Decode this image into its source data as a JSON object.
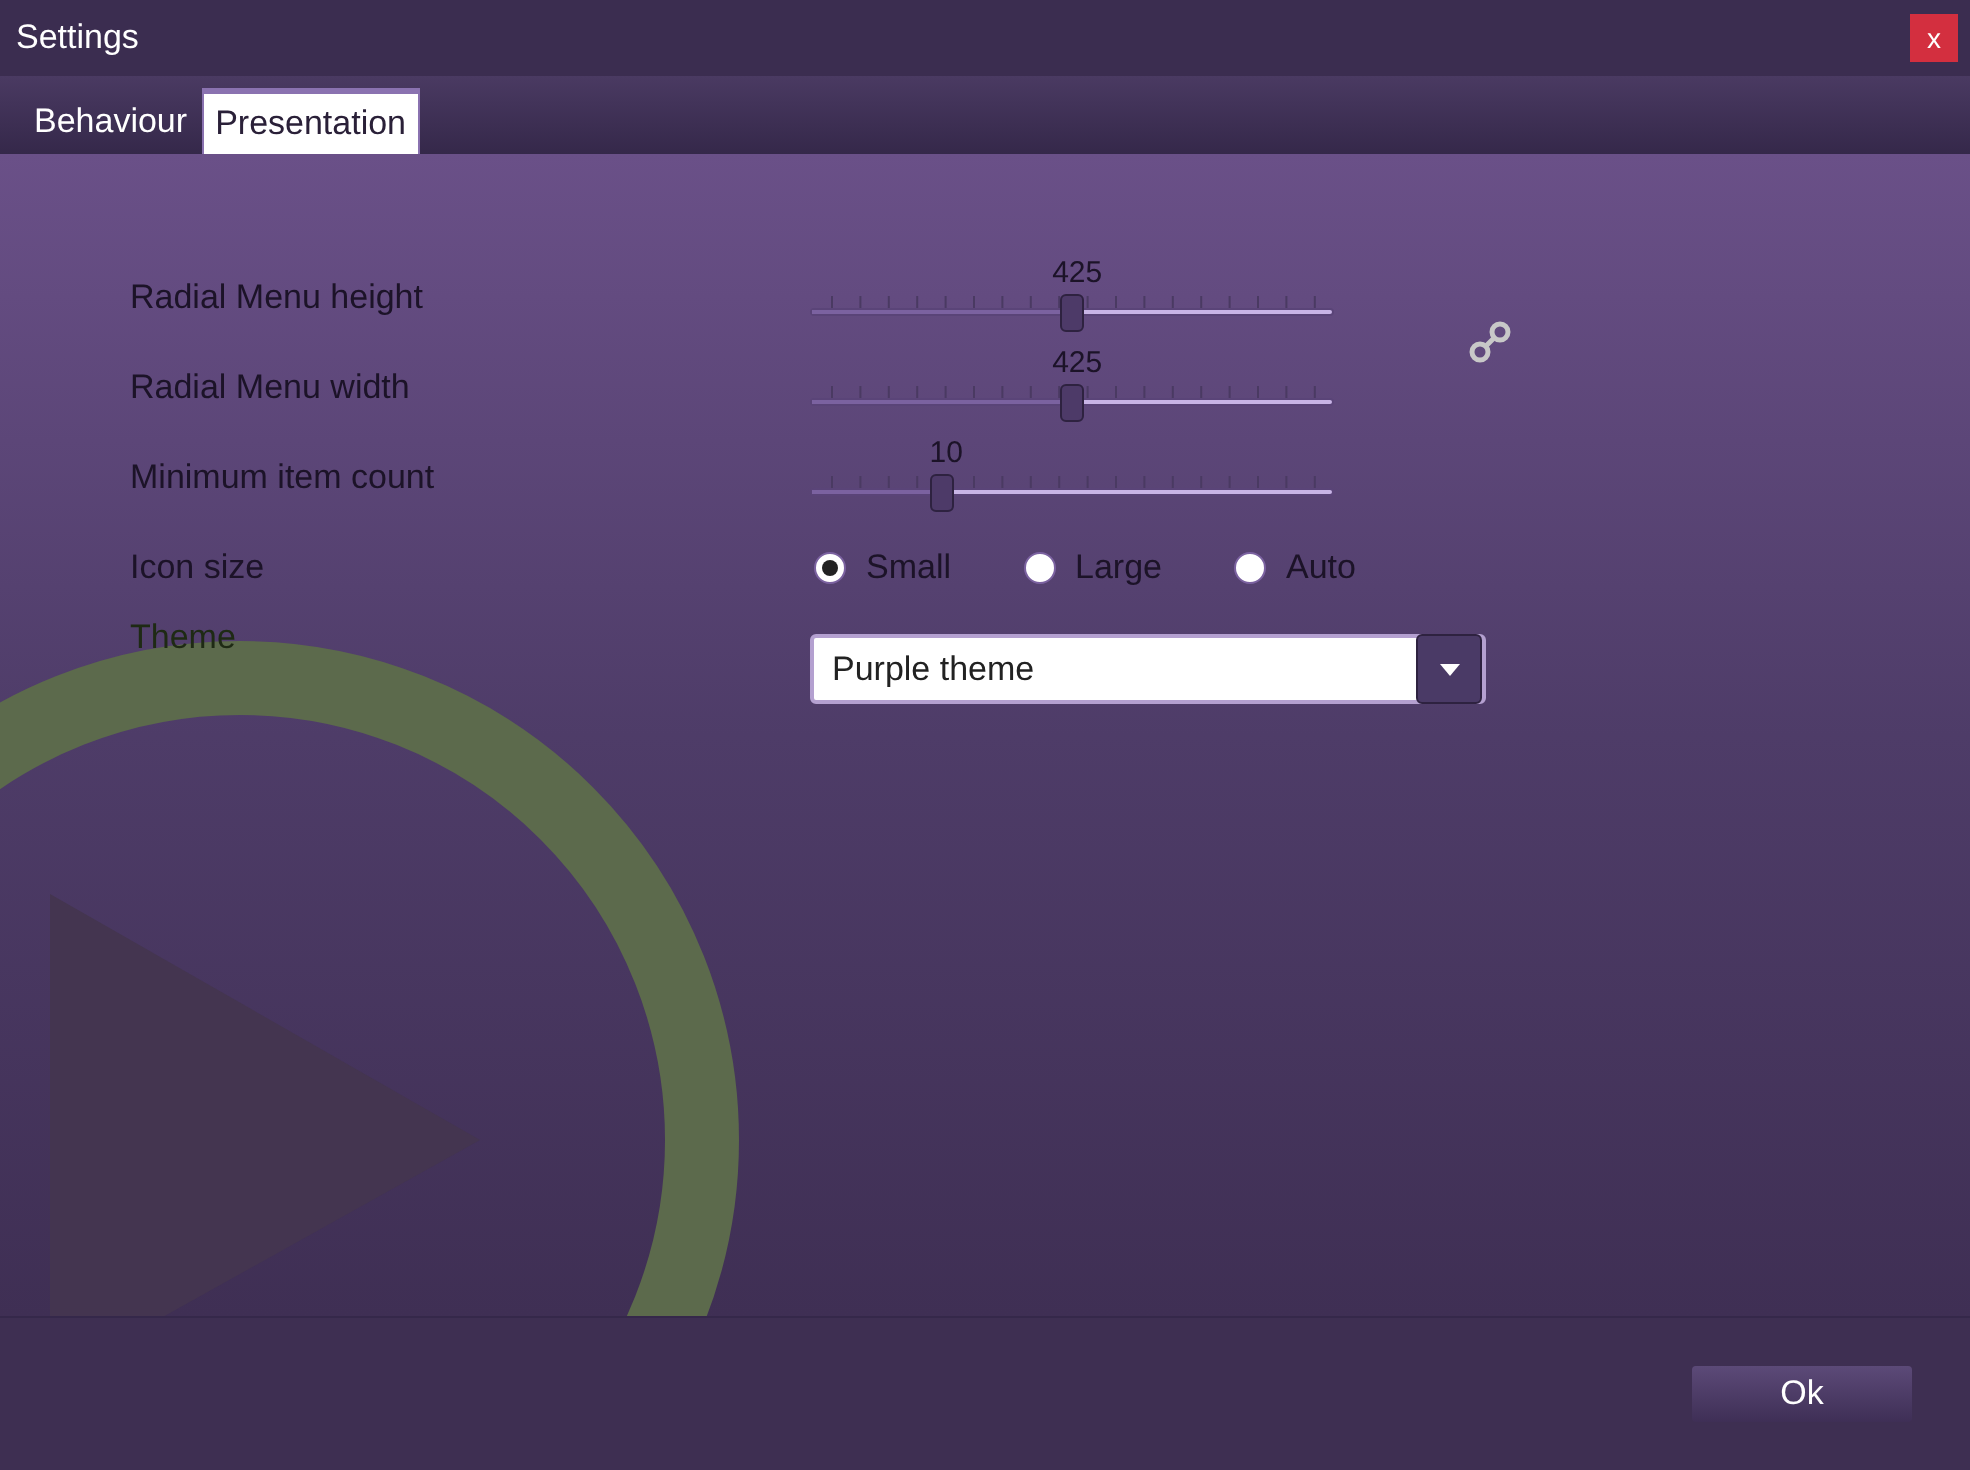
{
  "window": {
    "title": "Settings",
    "close": "x"
  },
  "tabs": [
    {
      "label": "Behaviour",
      "selected": false
    },
    {
      "label": "Presentation",
      "selected": true
    }
  ],
  "settings": [
    {
      "kind": "slider",
      "label": "Radial Menu height",
      "reading": "425",
      "level": 0.5
    },
    {
      "kind": "slider",
      "label": "Radial Menu width",
      "reading": "425",
      "level": 0.5
    },
    {
      "kind": "slider",
      "label": "Minimum item count",
      "reading": "10",
      "level": 0.25
    },
    {
      "kind": "radio",
      "label": "Icon size",
      "options": [
        {
          "label": "Small",
          "selected": true
        },
        {
          "label": "Large",
          "selected": false
        },
        {
          "label": "Auto",
          "selected": false
        }
      ]
    },
    {
      "kind": "dropdown",
      "label": "Theme",
      "value": "Purple theme"
    }
  ],
  "ok_button": "Ok"
}
